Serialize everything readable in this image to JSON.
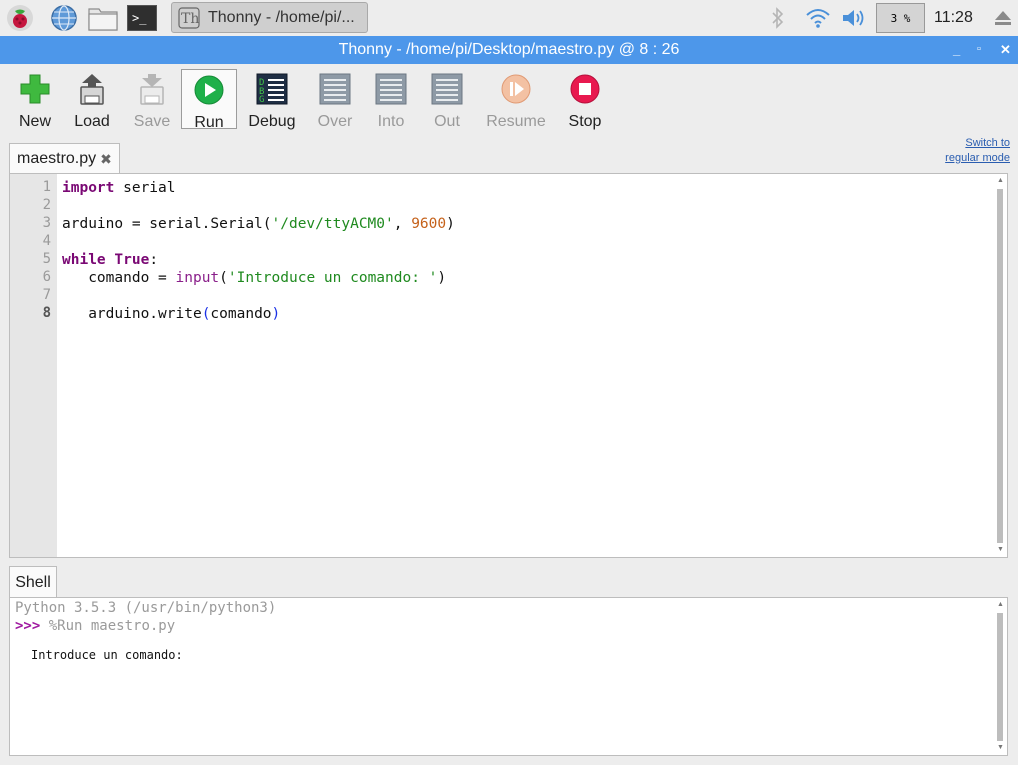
{
  "panel": {
    "task_title": "Thonny  -  /home/pi/...",
    "cpu_label": "3 %",
    "clock": "11:28",
    "icons": [
      "raspberry-menu-icon",
      "browser-globe-icon",
      "file-manager-icon",
      "terminal-icon",
      "thonny-icon",
      "bluetooth-icon",
      "wifi-icon",
      "volume-icon",
      "eject-icon"
    ]
  },
  "window": {
    "title": "Thonny  -  /home/pi/Desktop/maestro.py  @  8 : 26",
    "controls": [
      "_",
      "▫",
      "✕"
    ]
  },
  "toolbar": {
    "buttons": [
      {
        "label": "New",
        "icon": "new-plus-icon",
        "enabled": true
      },
      {
        "label": "Load",
        "icon": "load-icon",
        "enabled": true
      },
      {
        "label": "Save",
        "icon": "save-icon",
        "enabled": false
      },
      {
        "label": "Run",
        "icon": "run-play-icon",
        "enabled": true,
        "selected": true
      },
      {
        "label": "Debug",
        "icon": "debug-icon",
        "enabled": true
      },
      {
        "label": "Over",
        "icon": "step-over-icon",
        "enabled": false
      },
      {
        "label": "Into",
        "icon": "step-into-icon",
        "enabled": false
      },
      {
        "label": "Out",
        "icon": "step-out-icon",
        "enabled": false
      },
      {
        "label": "Resume",
        "icon": "resume-icon",
        "enabled": false
      },
      {
        "label": "Stop",
        "icon": "stop-icon",
        "enabled": true
      }
    ],
    "switch_mode_line1": "Switch to",
    "switch_mode_line2": "regular mode"
  },
  "editor": {
    "tab_label": "maestro.py",
    "tab_close": "✖",
    "current_line": 8,
    "line_numbers": [
      "1",
      "2",
      "3",
      "4",
      "5",
      "6",
      "7",
      "8"
    ],
    "lines": [
      "import serial",
      "",
      "arduino = serial.Serial('/dev/ttyACM0', 9600)",
      "",
      "while True:",
      "   comando = input('Introduce un comando: ')",
      "",
      "   arduino.write(comando)"
    ],
    "tokens": {
      "l1_kw": "import",
      "l1_rest": " serial",
      "l3_a": "arduino = serial.Serial(",
      "l3_str": "'/dev/ttyACM0'",
      "l3_b": ", ",
      "l3_num": "9600",
      "l3_c": ")",
      "l5_kw1": "while",
      "l5_sp": " ",
      "l5_kw2": "True",
      "l5_c": ":",
      "l6_a": "   comando = ",
      "l6_bi": "input",
      "l6_b": "(",
      "l6_str": "'Introduce un comando: '",
      "l6_c": ")",
      "l8_a": "   arduino.write",
      "l8_p1": "(",
      "l8_b": "comando",
      "l8_p2": ")"
    }
  },
  "shell": {
    "tab_label": "Shell",
    "version_line": "Python 3.5.3 (/usr/bin/python3)",
    "prompt": ">>>",
    "command": " %Run maestro.py",
    "output": "Introduce un comando:"
  },
  "colors": {
    "titlebar": "#4d97ea",
    "keyword": "#7a0874",
    "string": "#1f8a1f",
    "number": "#c5611a",
    "bracket": "#1a30e6",
    "prompt": "#a01aa0"
  }
}
